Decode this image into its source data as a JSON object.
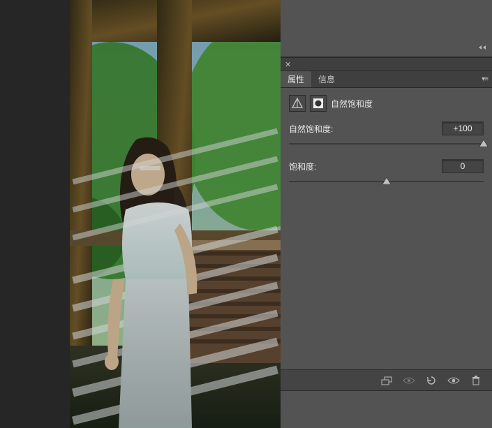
{
  "tabs": {
    "properties": "属性",
    "info": "信息"
  },
  "adjustment": {
    "title": "自然饱和度"
  },
  "sliders": {
    "vibrance": {
      "label": "自然饱和度:",
      "value": "+100",
      "pct": 100
    },
    "saturation": {
      "label": "饱和度:",
      "value": "0",
      "pct": 50
    }
  },
  "icons": {
    "mask": "mask-icon",
    "vib": "vibrance-adjustment-icon",
    "clip": "clip-to-layer-icon",
    "prev": "view-previous-state-icon",
    "reset": "reset-icon",
    "vis": "toggle-visibility-icon",
    "del": "delete-adjustment-icon"
  }
}
